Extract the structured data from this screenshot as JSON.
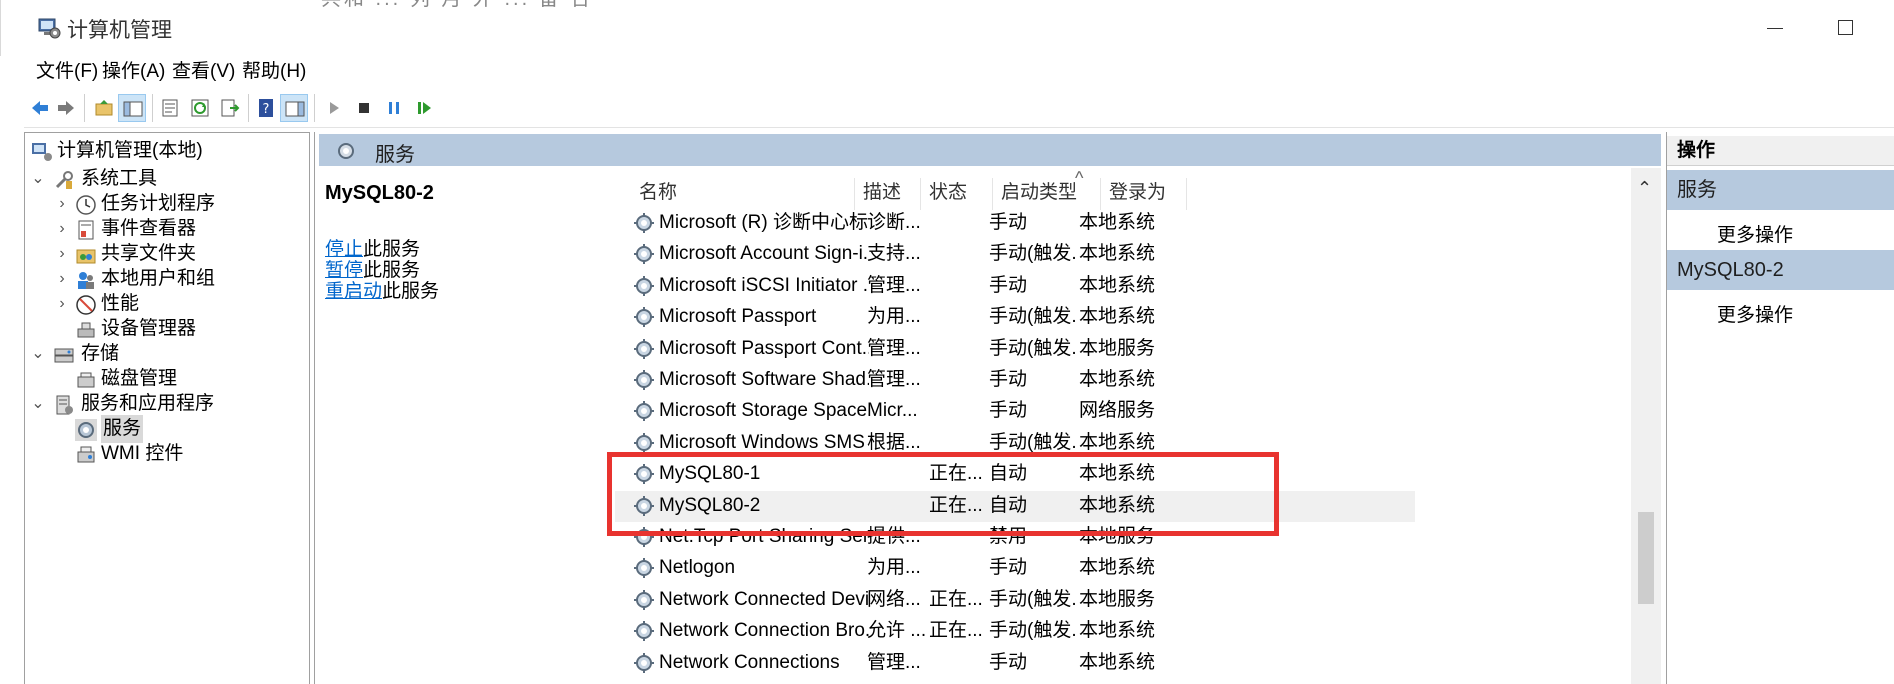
{
  "window": {
    "title": "计算机管理",
    "ghost_text": "共和 ... 列 月 外 ... 备 合"
  },
  "menu": [
    "文件(F)",
    "操作(A)",
    "查看(V)",
    "帮助(H)"
  ],
  "toolbar": {
    "icons": [
      "back-arrow-icon",
      "forward-arrow-icon",
      "up-folder-icon",
      "show-tree-icon",
      "properties-icon",
      "refresh-icon",
      "export-icon",
      "help-icon",
      "show-action-pane-icon",
      "start-service-icon",
      "stop-service-icon",
      "pause-service-icon",
      "resume-service-icon"
    ]
  },
  "tree": {
    "root": "计算机管理(本地)",
    "system_tools": "系统工具",
    "task_scheduler": "任务计划程序",
    "event_viewer": "事件查看器",
    "shared_folders": "共享文件夹",
    "local_users": "本地用户和组",
    "performance": "性能",
    "device_manager": "设备管理器",
    "storage": "存储",
    "disk_management": "磁盘管理",
    "services_apps": "服务和应用程序",
    "services": "服务",
    "wmi": "WMI 控件"
  },
  "middle": {
    "header": "服务",
    "selected_service": "MySQL80-2",
    "actions": [
      {
        "link": "停止",
        "rest": "此服务"
      },
      {
        "link": "暂停",
        "rest": "此服务"
      },
      {
        "link": "重启动",
        "rest": "此服务"
      }
    ]
  },
  "columns": {
    "name": "名称",
    "desc": "描述",
    "status": "状态",
    "startup": "启动类型",
    "login": "登录为"
  },
  "services": [
    {
      "name": "Microsoft (R) 诊断中心标...",
      "desc": "诊断...",
      "status": "",
      "startup": "手动",
      "login": "本地系统"
    },
    {
      "name": "Microsoft Account Sign-i...",
      "desc": "支持...",
      "status": "",
      "startup": "手动(触发...",
      "login": "本地系统"
    },
    {
      "name": "Microsoft iSCSI Initiator ...",
      "desc": "管理...",
      "status": "",
      "startup": "手动",
      "login": "本地系统"
    },
    {
      "name": "Microsoft Passport",
      "desc": "为用...",
      "status": "",
      "startup": "手动(触发...",
      "login": "本地系统"
    },
    {
      "name": "Microsoft Passport Cont...",
      "desc": "管理...",
      "status": "",
      "startup": "手动(触发...",
      "login": "本地服务"
    },
    {
      "name": "Microsoft Software Shad...",
      "desc": "管理...",
      "status": "",
      "startup": "手动",
      "login": "本地系统"
    },
    {
      "name": "Microsoft Storage Space...",
      "desc": "Micr...",
      "status": "",
      "startup": "手动",
      "login": "网络服务"
    },
    {
      "name": "Microsoft Windows SMS ...",
      "desc": "根据...",
      "status": "",
      "startup": "手动(触发...",
      "login": "本地系统"
    },
    {
      "name": "MySQL80-1",
      "desc": "",
      "status": "正在...",
      "startup": "自动",
      "login": "本地系统"
    },
    {
      "name": "MySQL80-2",
      "desc": "",
      "status": "正在...",
      "startup": "自动",
      "login": "本地系统"
    },
    {
      "name": "Net.Tcp Port Sharing Ser...",
      "desc": "提供...",
      "status": "",
      "startup": "禁用",
      "login": "本地服务"
    },
    {
      "name": "Netlogon",
      "desc": "为用...",
      "status": "",
      "startup": "手动",
      "login": "本地系统"
    },
    {
      "name": "Network Connected Devi...",
      "desc": "网络...",
      "status": "正在...",
      "startup": "手动(触发...",
      "login": "本地服务"
    },
    {
      "name": "Network Connection Bro...",
      "desc": "允许 ...",
      "status": "正在...",
      "startup": "手动(触发...",
      "login": "本地系统"
    },
    {
      "name": "Network Connections",
      "desc": "管理...",
      "status": "",
      "startup": "手动",
      "login": "本地系统"
    }
  ],
  "actions_pane": {
    "title": "操作",
    "section1": "服务",
    "more1": "更多操作",
    "section2": "MySQL80-2",
    "more2": "更多操作"
  },
  "colors": {
    "header_bg": "#b6c9de",
    "highlight": "#e8332f",
    "link": "#0066cc"
  }
}
